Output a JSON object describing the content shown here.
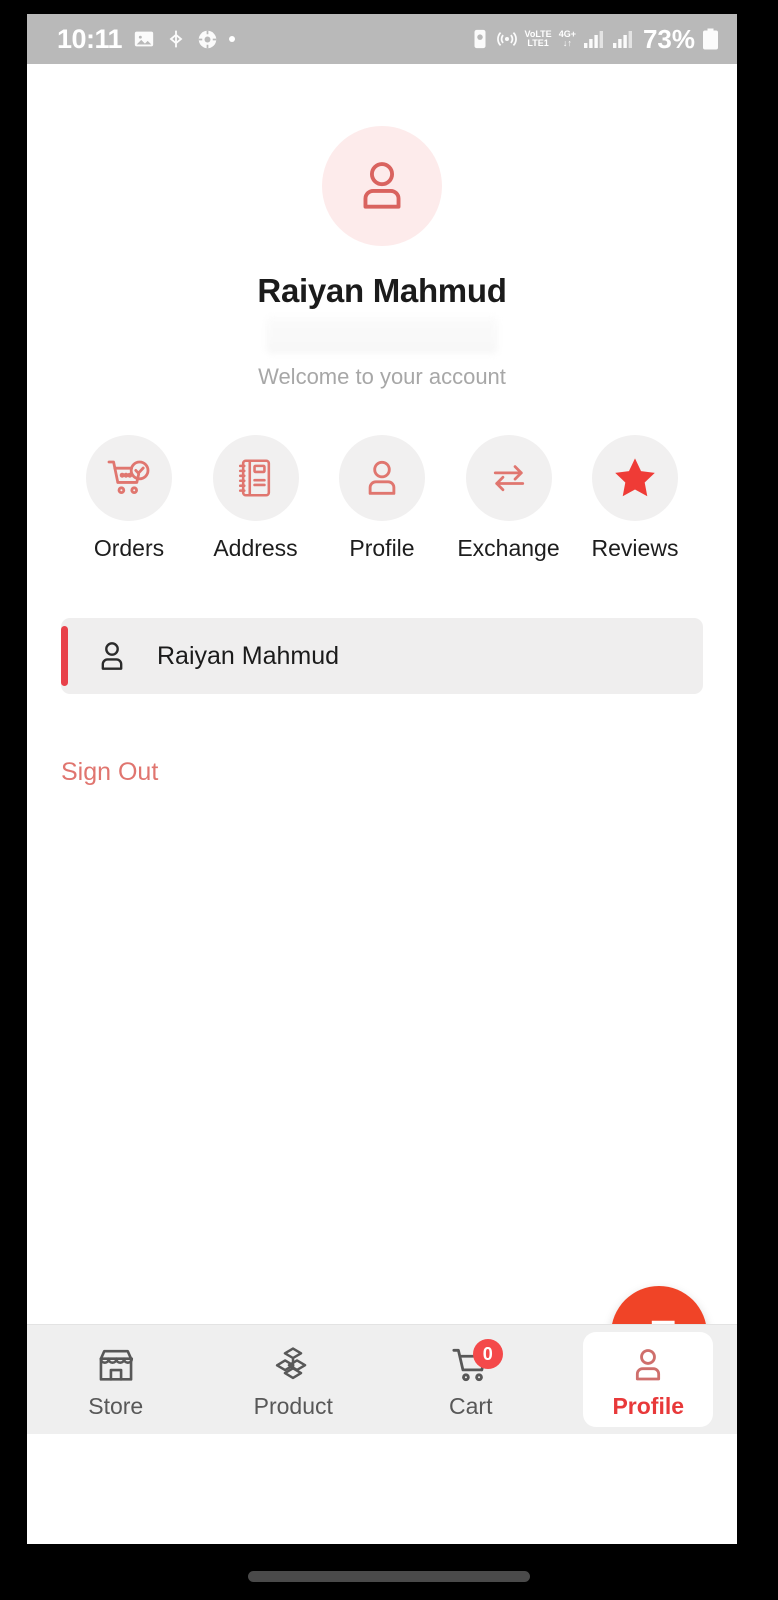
{
  "status_bar": {
    "time": "10:11",
    "left_icons": [
      "image-icon",
      "bluetooth-share-icon",
      "app-icon",
      "dot-icon"
    ],
    "volte_top": "VoLTE",
    "volte_bottom": "LTE1",
    "network_top": "4G+",
    "network_bottom": "↓↑",
    "battery_percent": "73%",
    "right_icons": [
      "camera-battery-icon",
      "hotspot-icon",
      "signal-1-icon",
      "signal-2-icon",
      "battery-icon"
    ]
  },
  "profile": {
    "name": "Raiyan Mahmud",
    "email_redacted": "",
    "welcome": "Welcome to your account",
    "avatar_icon": "user-icon"
  },
  "quick_actions": [
    {
      "label": "Orders",
      "icon": "cart-check-icon"
    },
    {
      "label": "Address",
      "icon": "address-book-icon"
    },
    {
      "label": "Profile",
      "icon": "user-icon"
    },
    {
      "label": "Exchange",
      "icon": "exchange-arrows-icon"
    },
    {
      "label": "Reviews",
      "icon": "star-icon"
    }
  ],
  "account_row": {
    "label": "Raiyan Mahmud",
    "icon": "user-icon"
  },
  "sign_out": {
    "label": "Sign Out"
  },
  "fab": {
    "icon": "chat-bubble-icon"
  },
  "bottom_nav": {
    "items": [
      {
        "label": "Store",
        "icon": "storefront-icon",
        "active": false,
        "badge": ""
      },
      {
        "label": "Product",
        "icon": "package-icon",
        "active": false,
        "badge": ""
      },
      {
        "label": "Cart",
        "icon": "cart-icon",
        "active": false,
        "badge": "0"
      },
      {
        "label": "Profile",
        "icon": "user-icon",
        "active": true,
        "badge": ""
      }
    ]
  },
  "colors": {
    "brand_red": "#e8393a",
    "accent_bar": "#e8414a",
    "fab_orange": "#f04427",
    "icon_red": "#e0766f",
    "star_red": "#ef3b36",
    "avatar_bg": "#fdebeb",
    "circle_bg": "#f1f0f0",
    "card_bg": "#efeeee",
    "nav_bg": "#efefef",
    "status_bg": "#b9b9b9",
    "muted_text": "#a7a7a7"
  }
}
